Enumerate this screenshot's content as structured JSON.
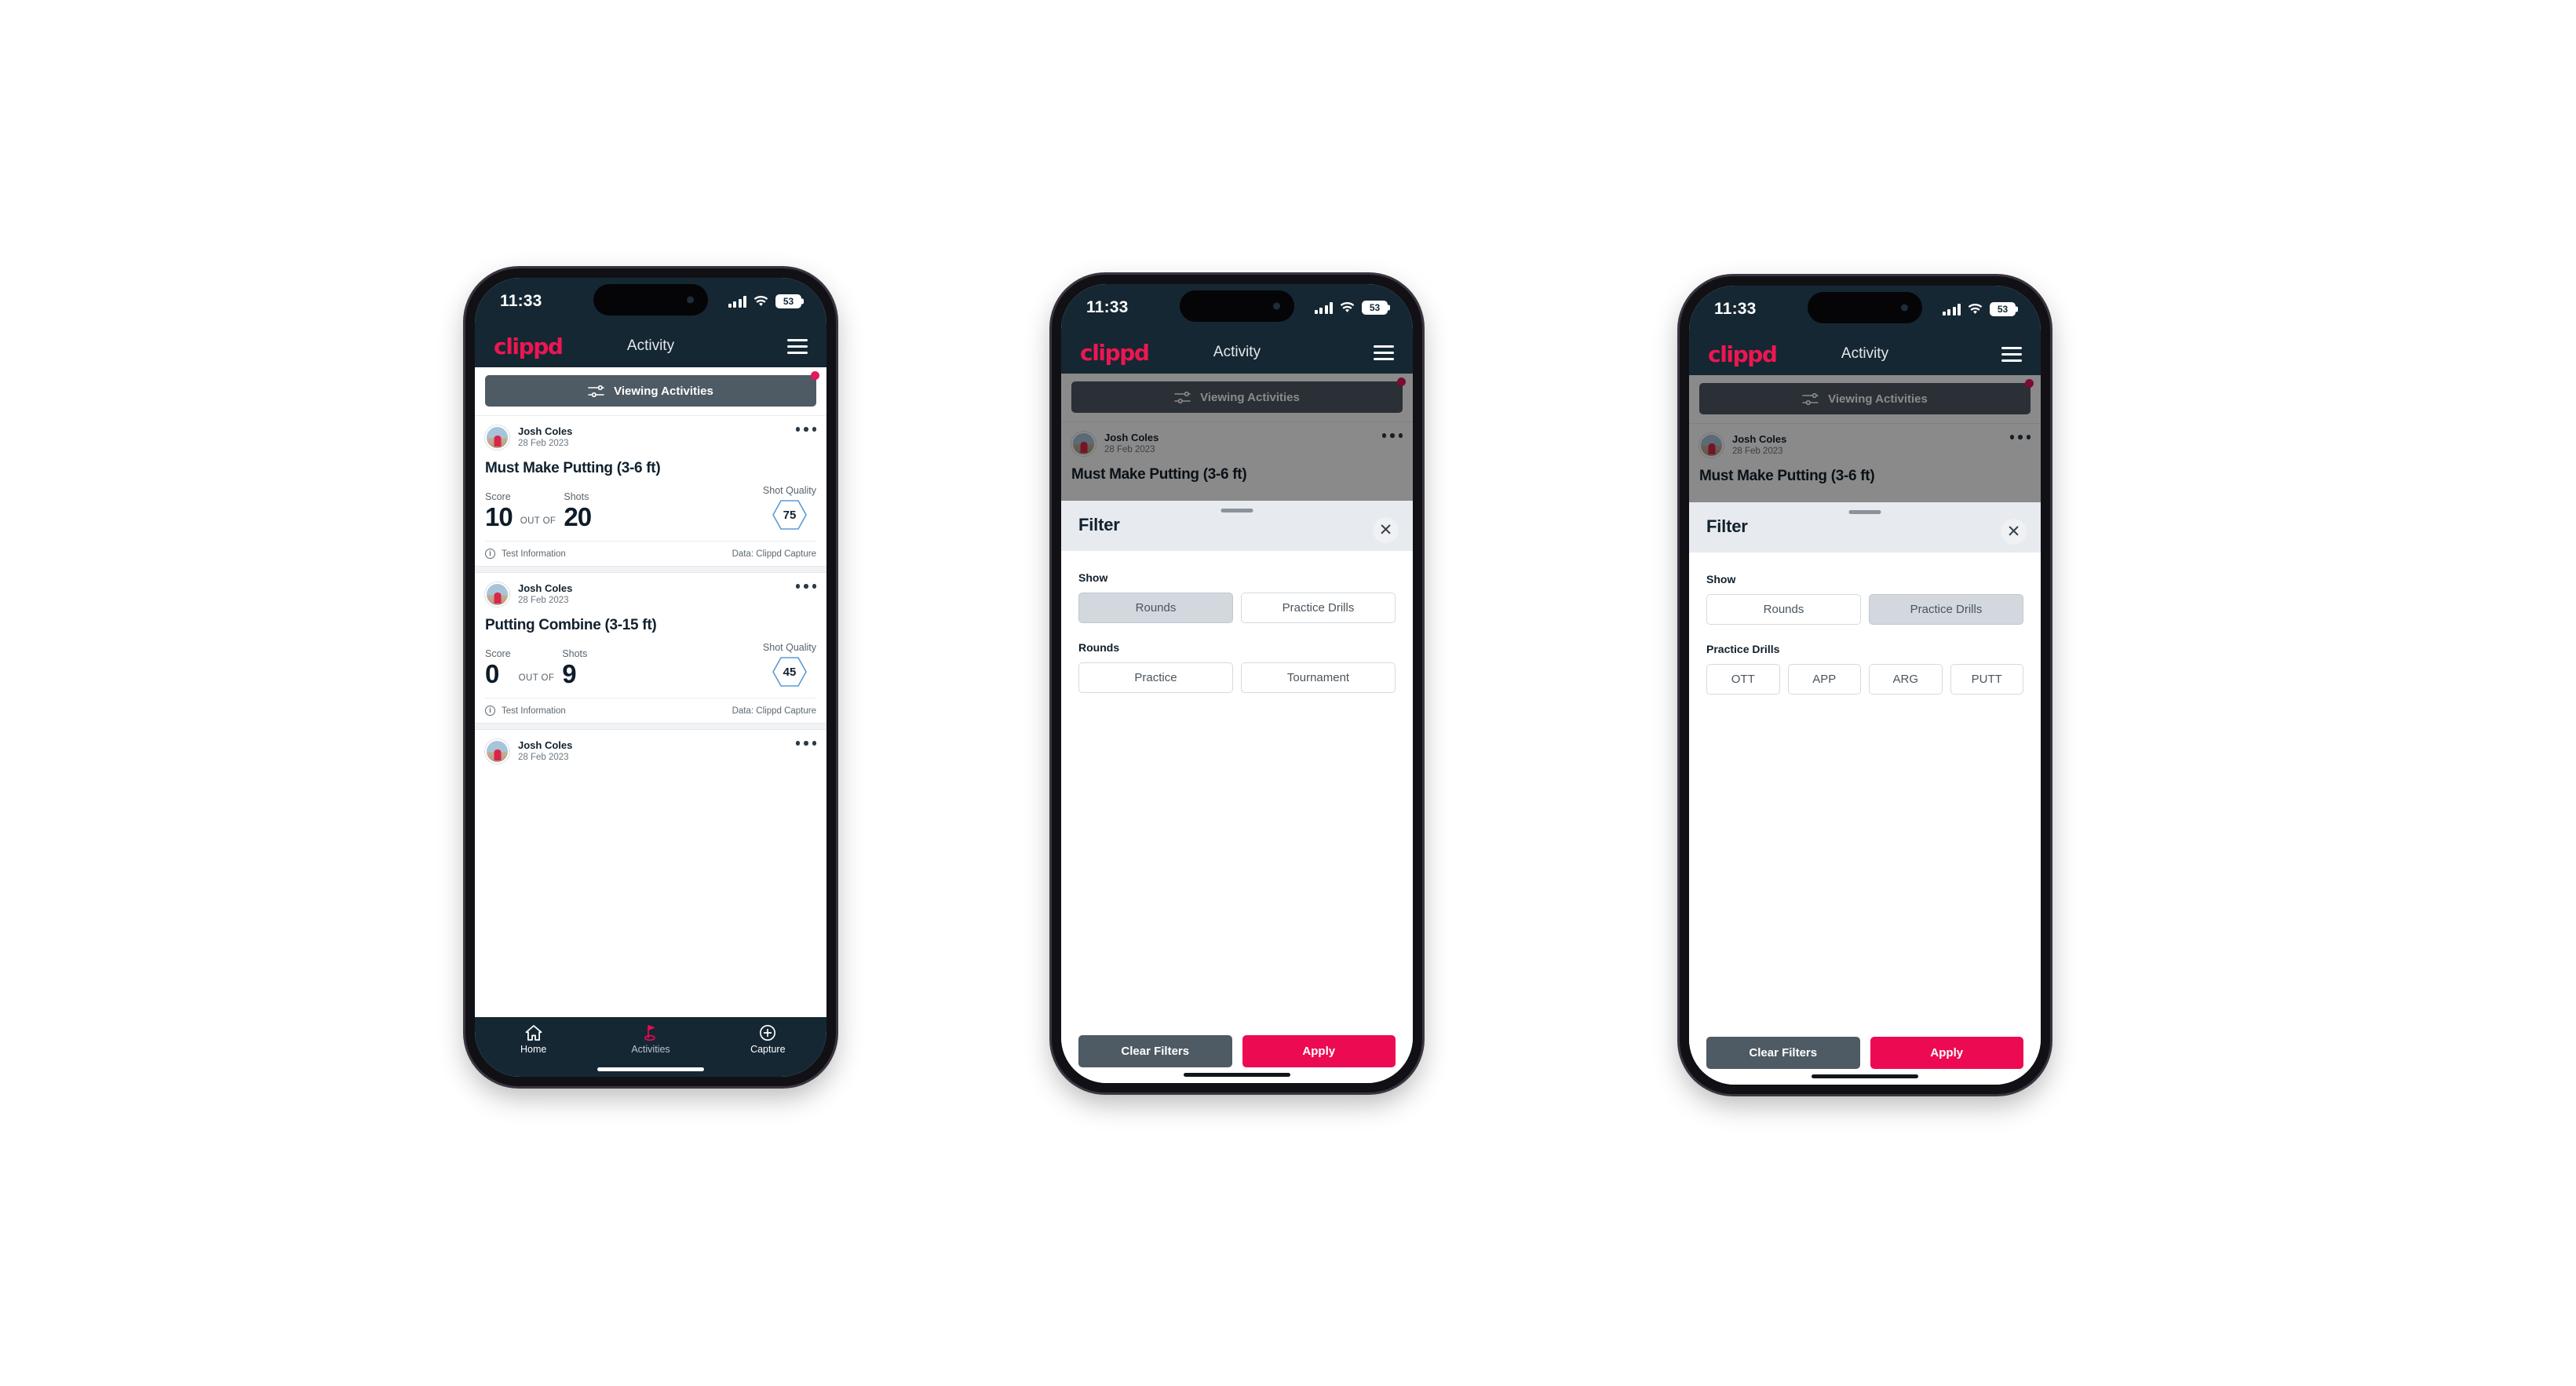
{
  "status_bar": {
    "time": "11:33",
    "battery": "53",
    "signal_icon": "cellular-bars-icon",
    "wifi_icon": "wifi-icon"
  },
  "app": {
    "logo": "clippd",
    "title": "Activity",
    "menu_icon": "hamburger-menu-icon",
    "filter_bar": {
      "label": "Viewing Activities",
      "icon": "sliders-filter-icon",
      "badge": "notification-dot"
    }
  },
  "activities": [
    {
      "user": "Josh Coles",
      "date": "28 Feb 2023",
      "title": "Must Make Putting (3-6 ft)",
      "score_label": "Score",
      "score_value": "10",
      "out_of": "OUT OF",
      "shots_label": "Shots",
      "shots_value": "20",
      "quality_label": "Shot Quality",
      "quality_value": "75",
      "footer_left": "Test Information",
      "footer_right": "Data: Clippd Capture"
    },
    {
      "user": "Josh Coles",
      "date": "28 Feb 2023",
      "title": "Putting Combine (3-15 ft)",
      "score_label": "Score",
      "score_value": "0",
      "out_of": "OUT OF",
      "shots_label": "Shots",
      "shots_value": "9",
      "quality_label": "Shot Quality",
      "quality_value": "45",
      "footer_left": "Test Information",
      "footer_right": "Data: Clippd Capture"
    },
    {
      "user": "Josh Coles",
      "date": "28 Feb 2023"
    }
  ],
  "bottom_nav": [
    {
      "label": "Home",
      "icon": "home-icon",
      "active": false
    },
    {
      "label": "Activities",
      "icon": "golf-flag-icon",
      "active": true
    },
    {
      "label": "Capture",
      "icon": "plus-circle-icon",
      "active": false
    }
  ],
  "filter_sheet": {
    "title": "Filter",
    "close_icon": "close-x-icon",
    "show_label": "Show",
    "show_options": [
      "Rounds",
      "Practice Drills"
    ],
    "rounds_label": "Rounds",
    "rounds_options": [
      "Practice",
      "Tournament"
    ],
    "drills_label": "Practice Drills",
    "drills_options": [
      "OTT",
      "APP",
      "ARG",
      "PUTT"
    ],
    "clear_label": "Clear Filters",
    "apply_label": "Apply"
  },
  "screens": {
    "phone2_selected_show": "Rounds",
    "phone3_selected_show": "Practice Drills"
  },
  "colors": {
    "brand_pink": "#ec0b53",
    "header_navy": "#152733",
    "slate": "#4e5a64",
    "hex_blue": "#5b9bd5"
  }
}
